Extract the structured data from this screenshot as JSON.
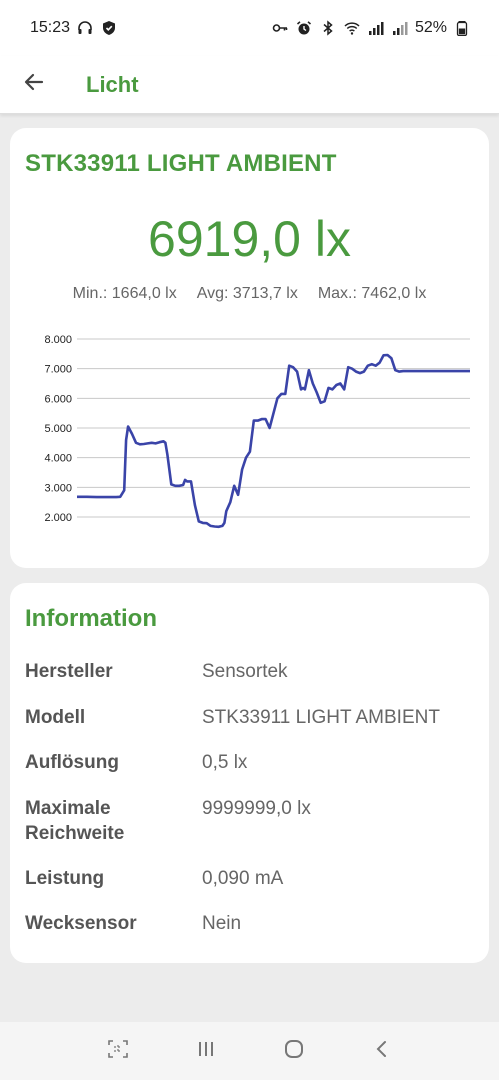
{
  "status_bar": {
    "time": "15:23",
    "battery": "52%",
    "left_icons": [
      "headphones-icon",
      "shield-icon"
    ],
    "right_icons": [
      "key-icon",
      "alarm-icon",
      "bluetooth-icon",
      "wifi-icon",
      "signal-icon",
      "signal-icon",
      "battery-icon"
    ]
  },
  "appbar": {
    "title": "Licht",
    "back_icon": "arrow-left-icon"
  },
  "sensor": {
    "name": "STK33911 LIGHT AMBIENT",
    "current_value": "6919,0 lx",
    "min": "Min.: 1664,0 lx",
    "avg": "Avg: 3713,7 lx",
    "max": "Max.: 7462,0 lx"
  },
  "chart_data": {
    "type": "line",
    "title": "",
    "xlabel": "",
    "ylabel": "",
    "ylim": [
      1500,
      8200
    ],
    "y_ticks": [
      "2.000",
      "3.000",
      "4.000",
      "5.000",
      "6.000",
      "7.000",
      "8.000"
    ],
    "y_tick_values": [
      2000,
      3000,
      4000,
      5000,
      6000,
      7000,
      8000
    ],
    "grid": true,
    "color": "#3a44a8",
    "series": [
      {
        "name": "",
        "x": [
          0,
          5,
          10,
          15,
          20,
          22,
          24,
          25,
          26,
          28,
          30,
          32,
          34,
          36,
          38,
          40,
          42,
          44,
          45,
          46,
          48,
          50,
          52,
          54,
          55,
          56,
          58,
          60,
          62,
          64,
          66,
          68,
          70,
          72,
          74,
          75,
          76,
          78,
          80,
          82,
          84,
          86,
          88,
          90,
          92,
          94,
          96,
          98,
          100,
          102,
          104,
          106,
          108,
          110,
          112,
          114,
          115,
          116,
          118,
          120,
          122,
          124,
          126,
          128,
          130,
          132,
          134,
          136,
          138,
          140,
          142,
          144,
          146,
          148,
          150,
          152,
          154,
          156,
          158,
          160,
          162,
          164,
          166,
          168,
          170,
          172,
          174,
          176,
          178,
          180,
          182,
          184,
          186,
          188,
          190,
          192,
          194,
          196,
          198,
          200
        ],
        "y": [
          2680,
          2680,
          2670,
          2670,
          2670,
          2680,
          2900,
          4600,
          5050,
          4800,
          4500,
          4450,
          4460,
          4480,
          4500,
          4480,
          4520,
          4550,
          4500,
          4100,
          3100,
          3050,
          3050,
          3080,
          3250,
          3200,
          3200,
          2400,
          1850,
          1800,
          1790,
          1700,
          1680,
          1670,
          1700,
          1800,
          2200,
          2500,
          3050,
          2750,
          3600,
          4000,
          4200,
          5250,
          5250,
          5300,
          5300,
          5000,
          5500,
          6000,
          6150,
          6150,
          7100,
          7050,
          6900,
          6300,
          6350,
          6300,
          6950,
          6500,
          6200,
          5850,
          5900,
          6350,
          6300,
          6450,
          6500,
          6300,
          7050,
          7000,
          6900,
          6850,
          6900,
          7100,
          7150,
          7100,
          7200,
          7450,
          7460,
          7350,
          6950,
          6900,
          6919,
          6919,
          6919,
          6919,
          6919,
          6919,
          6919,
          6919,
          6919,
          6919,
          6919,
          6919,
          6919,
          6919,
          6919,
          6919,
          6919,
          6919
        ]
      }
    ]
  },
  "info": {
    "heading": "Information",
    "rows": [
      {
        "label": "Hersteller",
        "value": "Sensortek"
      },
      {
        "label": "Modell",
        "value": "STK33911 LIGHT AMBIENT"
      },
      {
        "label": "Auflösung",
        "value": "0,5 lx"
      },
      {
        "label": "Maximale Reichweite",
        "value": "9999999,0 lx"
      },
      {
        "label": "Leistung",
        "value": "0,090 mA"
      },
      {
        "label": "Wecksensor",
        "value": "Nein"
      }
    ]
  },
  "navbar": {
    "icons": [
      "screenshot-icon",
      "recent-apps-icon",
      "home-icon",
      "back-icon"
    ]
  }
}
